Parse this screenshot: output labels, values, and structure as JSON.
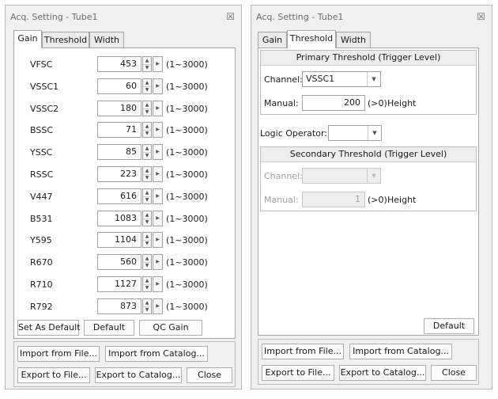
{
  "left_window": {
    "title": "Acq. Setting - Tube1",
    "close": "☒",
    "tabs": [
      "Gain",
      "Threshold",
      "Width"
    ],
    "rows": [
      {
        "label": "VFSC",
        "value": "453",
        "range": "(1~3000)"
      },
      {
        "label": "VSSC1",
        "value": "60",
        "range": "(1~3000)"
      },
      {
        "label": "VSSC2",
        "value": "180",
        "range": "(1~3000)"
      },
      {
        "label": "BSSC",
        "value": "71",
        "range": "(1~3000)"
      },
      {
        "label": "YSSC",
        "value": "85",
        "range": "(1~3000)"
      },
      {
        "label": "RSSC",
        "value": "223",
        "range": "(1~3000)"
      },
      {
        "label": "V447",
        "value": "616",
        "range": "(1~3000)"
      },
      {
        "label": "B531",
        "value": "1083",
        "range": "(1~3000)"
      },
      {
        "label": "Y595",
        "value": "1104",
        "range": "(1~3000)"
      },
      {
        "label": "R670",
        "value": "560",
        "range": "(1~3000)"
      },
      {
        "label": "R710",
        "value": "1127",
        "range": "(1~3000)"
      },
      {
        "label": "R792",
        "value": "873",
        "range": "(1~3000)"
      }
    ],
    "buttons": {
      "set_default": "Set As Default",
      "default": "Default",
      "qc_gain": "QC Gain",
      "import_file": "Import from File...",
      "import_catalog": "Import from Catalog...",
      "export_file": "Export to File...",
      "export_catalog": "Export to Catalog...",
      "close": "Close"
    }
  },
  "right_window": {
    "title": "Acq. Setting - Tube1",
    "close": "☒",
    "tabs": [
      "Gain",
      "Threshold",
      "Width"
    ],
    "primary": {
      "header": "Primary Threshold (Trigger Level)",
      "channel_label": "Channel:",
      "channel_value": "VSSC1",
      "manual_label": "Manual:",
      "manual_value": "200",
      "unit": "(>0)",
      "height": "Height"
    },
    "logic_label": "Logic Operator:",
    "logic_value": "",
    "secondary": {
      "header": "Secondary Threshold (Trigger Level)",
      "channel_label": "Channel:",
      "channel_value": "",
      "manual_label": "Manual:",
      "manual_value": "1",
      "unit": "(>0)",
      "height": "Height"
    },
    "buttons": {
      "default": "Default",
      "import_file": "Import from File...",
      "import_catalog": "Import from Catalog...",
      "export_file": "Export to File...",
      "export_catalog": "Export to Catalog...",
      "close": "Close"
    }
  }
}
